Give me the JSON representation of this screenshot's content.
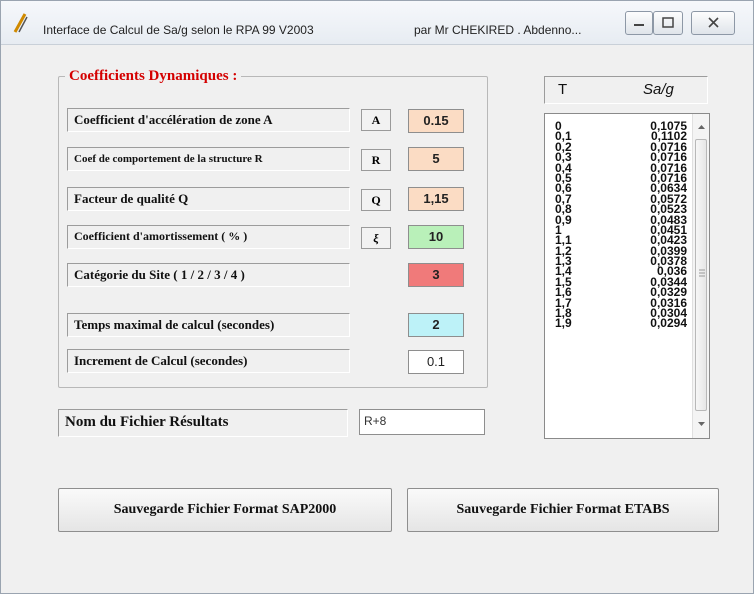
{
  "window": {
    "title": "Interface de Calcul de Sa/g selon le RPA 99 V2003",
    "author": "par  Mr CHEKIRED . Abdenno..."
  },
  "group": {
    "title": "Coefficients Dynamiques :",
    "rows": [
      {
        "label": "Coefficient d'accélération de zone   A",
        "button": "A",
        "value": "0.15",
        "color": "#fbdcc4"
      },
      {
        "label": "Coef de comportement de la structure  R",
        "button": "R",
        "value": "5",
        "color": "#fbdcc4"
      },
      {
        "label": "Facteur de qualité   Q",
        "button": "Q",
        "value": "1,15",
        "color": "#fbdcc4"
      },
      {
        "label": "Coefficient d'amortissement ( % )",
        "button": "ξ",
        "value": "10",
        "color": "#b9f0b9"
      },
      {
        "label": "Catégorie du Site   ( 1 / 2 / 3 / 4 )",
        "button": "",
        "value": "3",
        "color": "#f07a7a"
      },
      {
        "label": "Temps maximal de calcul  (secondes)",
        "button": "",
        "value": "2",
        "color": "#bdf2f8"
      },
      {
        "label": "Increment de Calcul  (secondes)",
        "button": "",
        "value": "0.1",
        "color": "#ffffff"
      }
    ]
  },
  "file": {
    "label": "Nom du Fichier Résultats",
    "value": "R+8"
  },
  "table": {
    "col_t": "T",
    "col_s": "Sa/g",
    "rows": [
      [
        "0",
        "0,1075"
      ],
      [
        "0,1",
        "0,1102"
      ],
      [
        "0,2",
        "0,0716"
      ],
      [
        "0,3",
        "0,0716"
      ],
      [
        "0,4",
        "0,0716"
      ],
      [
        "0,5",
        "0,0716"
      ],
      [
        "0,6",
        "0,0634"
      ],
      [
        "0,7",
        "0,0572"
      ],
      [
        "0,8",
        "0,0523"
      ],
      [
        "0,9",
        "0,0483"
      ],
      [
        "1",
        "0,0451"
      ],
      [
        "1,1",
        "0,0423"
      ],
      [
        "1,2",
        "0,0399"
      ],
      [
        "1,3",
        "0,0378"
      ],
      [
        "1,4",
        "0,036"
      ],
      [
        "1,5",
        "0,0344"
      ],
      [
        "1,6",
        "0,0329"
      ],
      [
        "1,7",
        "0,0316"
      ],
      [
        "1,8",
        "0,0304"
      ],
      [
        "1,9",
        "0,0294"
      ]
    ]
  },
  "buttons": {
    "sap": "Sauvegarde Fichier Format SAP2000",
    "etabs": "Sauvegarde Fichier Format  ETABS"
  }
}
